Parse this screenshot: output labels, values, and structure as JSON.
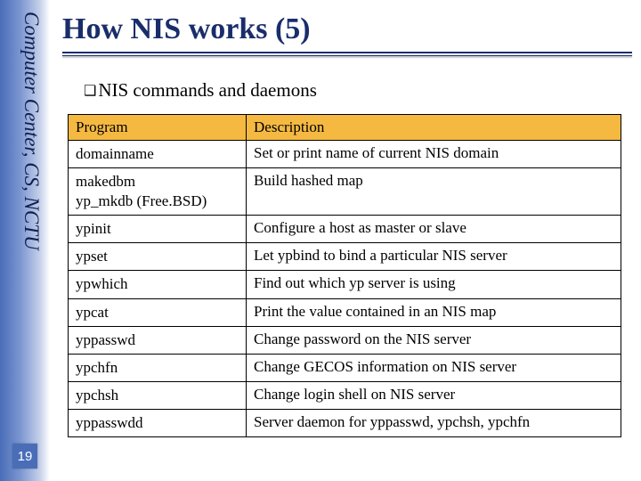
{
  "sidebar": {
    "label": "Computer Center, CS, NCTU",
    "page_number": "19"
  },
  "title": "How NIS works (5)",
  "bullet": "NIS commands and daemons",
  "table": {
    "headers": {
      "program": "Program",
      "description": "Description"
    },
    "rows": [
      {
        "program": "domainname",
        "description": "Set or print name of current NIS domain"
      },
      {
        "program": "makedbm\nyp_mkdb (Free.BSD)",
        "description": "Build hashed map"
      },
      {
        "program": "ypinit",
        "description": "Configure a host as master or slave"
      },
      {
        "program": "ypset",
        "description": "Let ypbind to bind a particular NIS server"
      },
      {
        "program": "ypwhich",
        "description": "Find out which yp server is using"
      },
      {
        "program": "ypcat",
        "description": "Print the value contained in an NIS map"
      },
      {
        "program": "yppasswd",
        "description": "Change password on the NIS server"
      },
      {
        "program": "ypchfn",
        "description": "Change GECOS information on NIS server"
      },
      {
        "program": "ypchsh",
        "description": "Change login shell on NIS server"
      },
      {
        "program": "yppasswdd",
        "description": "Server daemon for yppasswd, ypchsh, ypchfn"
      }
    ]
  }
}
